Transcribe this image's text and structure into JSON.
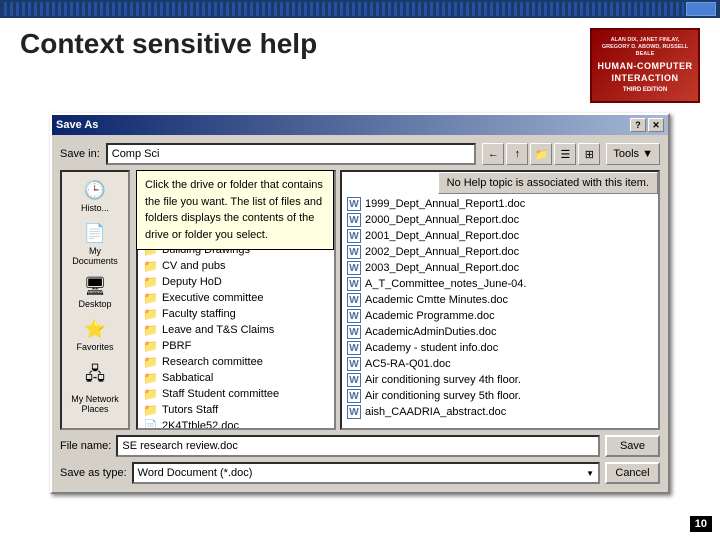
{
  "topbar": {
    "label": "top navigation bar"
  },
  "header": {
    "title": "Context sensitive help",
    "book": {
      "authors": "ALAN DIX, JANET FINLAY, GREGORY D. ABOWD, RUSSELL BEALE",
      "title": "HUMAN-COMPUTER INTERACTION",
      "edition": "THIRD EDITION"
    }
  },
  "dialog": {
    "title": "Save As",
    "titlebar_buttons": [
      "?",
      "×"
    ],
    "save_in_label": "Save in:",
    "save_in_value": "Comp Sci",
    "toolbar_buttons": [
      "←",
      "↑",
      "📁",
      "📋"
    ],
    "tools_label": "Tools ▼",
    "places": [
      {
        "label": "Histo...",
        "icon": "🕒"
      },
      {
        "label": "My Documents",
        "icon": "📄"
      },
      {
        "label": "Desktop",
        "icon": "🖥"
      },
      {
        "label": "Favorites",
        "icon": "⭐"
      },
      {
        "label": "My Network Places",
        "icon": "🖧"
      }
    ],
    "tooltip": "Click the drive or folder that contains the file you want. The list of files and folders displays the contents of the drive or folder you select.",
    "no_help_text": "No Help topic is associated with this item.",
    "folders": [
      "Building Drawings",
      "CV and pubs",
      "Deputy HoD",
      "Executive committee",
      "Faculty staffing",
      "Leave and T&S Claims",
      "PBRF",
      "Research committee",
      "Sabbatical",
      "Staff Student committee",
      "Tutors Staff"
    ],
    "files": [
      "1999_Dept_Annual_Report1.doc",
      "2000_Dept_Annual_Report.doc",
      "2001_Dept_Annual_Report.doc",
      "2002_Dept_Annual_Report.doc",
      "2003_Dept_Annual_Report.doc",
      "A_T_Committee_notes_June-04.",
      "Academic Cmtte Minutes.doc",
      "Academic Programme.doc",
      "AcademicAdminDuties.doc",
      "Academy - student info.doc",
      "AC5-RA-Q01.doc",
      "Air conditioning survey 4th floor.",
      "Air conditioning survey 5th floor.",
      "aish_CAADRIA_abstract.doc"
    ],
    "file_name_label": "File name:",
    "file_name_value": "SE research review.doc",
    "save_as_type_label": "Save as type:",
    "save_as_type_value": "Word Document (*.doc)",
    "save_button": "Save",
    "cancel_button": "Cancel",
    "folder_file": "2K4Ttble52.doc"
  },
  "page_number": "10"
}
